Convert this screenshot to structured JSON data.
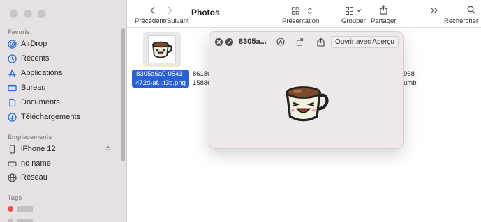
{
  "sidebar": {
    "favorites_title": "Favoris",
    "favorites": [
      {
        "label": "AirDrop",
        "icon": "airdrop-icon"
      },
      {
        "label": "Récents",
        "icon": "clock-icon"
      },
      {
        "label": "Applications",
        "icon": "applications-icon"
      },
      {
        "label": "Bureau",
        "icon": "desktop-icon"
      },
      {
        "label": "Documents",
        "icon": "document-icon"
      },
      {
        "label": "Téléchargements",
        "icon": "download-icon"
      }
    ],
    "locations_title": "Emplacements",
    "locations": [
      {
        "label": "iPhone 12",
        "icon": "iphone-icon"
      },
      {
        "label": "no name",
        "icon": "disk-icon"
      },
      {
        "label": "Réseau",
        "icon": "globe-icon"
      }
    ],
    "tags_title": "Tags",
    "accent": "#2a6fd9"
  },
  "toolbar": {
    "nav_label": "Précédent/Suivant",
    "title": "Photos",
    "view_label": "Présentation",
    "group_label": "Grouper",
    "share_label": "Partager",
    "search_label": "Rechercher"
  },
  "files": {
    "selected_name_line1": "8305a6a0-0541-",
    "selected_name_line2": "472d-af...f3b.png",
    "partial_left_line1": "86180",
    "partial_left_line2": "15886",
    "partial_right_line1": "968-",
    "partial_right_line2": "umb"
  },
  "quicklook": {
    "title": "8305a...",
    "open_label": "Ouvrir avec Aperçu"
  }
}
